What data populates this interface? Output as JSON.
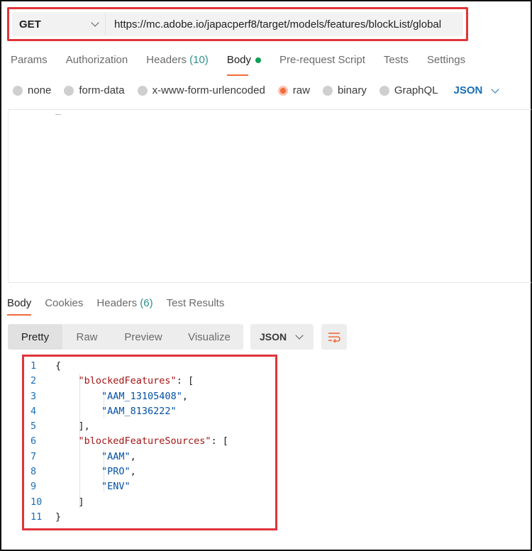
{
  "request": {
    "method": "GET",
    "url": "https://mc.adobe.io/japacperf8/target/models/features/blockList/global"
  },
  "request_tabs": [
    {
      "label": "Params"
    },
    {
      "label": "Authorization"
    },
    {
      "label": "Headers",
      "count": "(10)"
    },
    {
      "label": "Body"
    },
    {
      "label": "Pre-request Script"
    },
    {
      "label": "Tests"
    },
    {
      "label": "Settings"
    }
  ],
  "body_types": [
    "none",
    "form-data",
    "x-www-form-urlencoded",
    "raw",
    "binary",
    "GraphQL"
  ],
  "body_type_selected": "raw",
  "body_format": "JSON",
  "response_tabs": [
    {
      "label": "Body"
    },
    {
      "label": "Cookies"
    },
    {
      "label": "Headers",
      "count": "(6)"
    },
    {
      "label": "Test Results"
    }
  ],
  "view_modes": [
    "Pretty",
    "Raw",
    "Preview",
    "Visualize"
  ],
  "view_selected": "Pretty",
  "response_format": "JSON",
  "response_json": {
    "line_numbers": [
      "1",
      "2",
      "3",
      "4",
      "5",
      "6",
      "7",
      "8",
      "9",
      "10",
      "11"
    ],
    "open_brace": "{",
    "close_brace": "}",
    "key_blocked_features": "\"blockedFeatures\"",
    "val_1": "\"AAM_13105408\"",
    "val_2": "\"AAM_8136222\"",
    "key_blocked_sources": "\"blockedFeatureSources\"",
    "src_1": "\"AAM\"",
    "src_2": "\"PRO\"",
    "src_3": "\"ENV\""
  },
  "colors": {
    "highlight_border": "#e0343a",
    "active_tab_underline": "#f26b3a",
    "json_key": "#a31515",
    "json_string": "#0451a5",
    "success_dot": "#0c9f55"
  }
}
